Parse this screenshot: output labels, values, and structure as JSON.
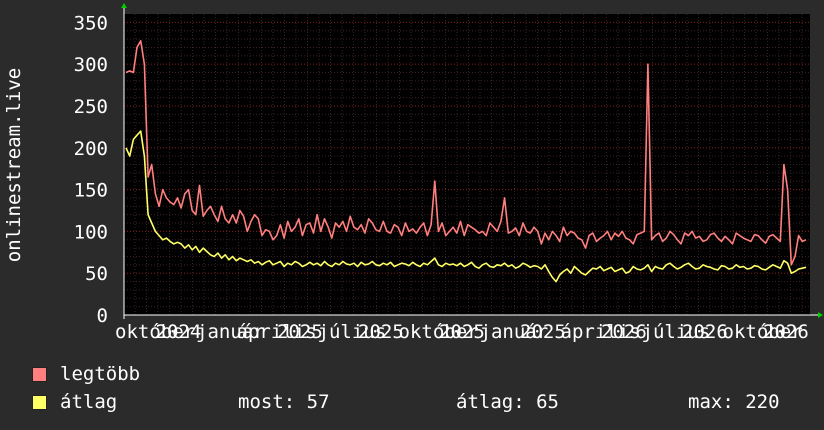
{
  "chart_data": {
    "type": "line",
    "ylabel": "onlinestream.live",
    "ylim": [
      0,
      360
    ],
    "yticks": [
      0,
      50,
      100,
      150,
      200,
      250,
      300,
      350
    ],
    "x_tick_labels": [
      "október",
      "2024",
      "január",
      "április",
      "2025",
      "július",
      "2025",
      "október",
      "2025",
      "január",
      "2025",
      "április",
      "2026",
      "július",
      "2026",
      "október",
      "2026"
    ],
    "grid": true,
    "colors": {
      "background": "#000000",
      "grid": "#8a1c1c",
      "max": "#ff7f7f",
      "avg": "#ffff66"
    },
    "series": [
      {
        "name": "legtöbb",
        "color": "#ff7f7f",
        "values": [
          290,
          292,
          290,
          320,
          328,
          300,
          165,
          180,
          145,
          130,
          150,
          140,
          135,
          132,
          140,
          128,
          145,
          150,
          125,
          120,
          155,
          118,
          125,
          130,
          120,
          112,
          130,
          115,
          110,
          120,
          110,
          125,
          118,
          100,
          112,
          120,
          115,
          95,
          102,
          100,
          90,
          95,
          108,
          92,
          112,
          100,
          105,
          115,
          95,
          108,
          110,
          98,
          120,
          100,
          115,
          105,
          92,
          110,
          105,
          112,
          100,
          118,
          105,
          102,
          108,
          98,
          115,
          110,
          102,
          100,
          112,
          100,
          98,
          108,
          105,
          95,
          110,
          100,
          103,
          98,
          105,
          110,
          95,
          108,
          160,
          100,
          110,
          95,
          100,
          105,
          98,
          112,
          95,
          108,
          105,
          102,
          98,
          100,
          95,
          110,
          105,
          100,
          112,
          140,
          98,
          100,
          104,
          95,
          110,
          100,
          98,
          105,
          100,
          85,
          98,
          90,
          100,
          95,
          88,
          105,
          95,
          100,
          98,
          92,
          90,
          80,
          95,
          98,
          88,
          92,
          95,
          100,
          90,
          98,
          94,
          100,
          92,
          90,
          85,
          96,
          98,
          100,
          300,
          90,
          95,
          98,
          88,
          92,
          100,
          96,
          90,
          85,
          98,
          95,
          100,
          92,
          94,
          88,
          90,
          96,
          98,
          92,
          88,
          94,
          90,
          85,
          98,
          95,
          92,
          90,
          88,
          96,
          95,
          90,
          86,
          94,
          96,
          92,
          88,
          180,
          150,
          60,
          70,
          95,
          88,
          90
        ]
      },
      {
        "name": "átlag",
        "color": "#ffff66",
        "values": [
          200,
          190,
          210,
          215,
          220,
          190,
          120,
          110,
          100,
          95,
          90,
          92,
          88,
          85,
          87,
          85,
          80,
          84,
          78,
          82,
          75,
          80,
          76,
          72,
          70,
          74,
          68,
          72,
          66,
          70,
          65,
          68,
          66,
          64,
          66,
          62,
          64,
          60,
          63,
          65,
          60,
          62,
          64,
          58,
          62,
          60,
          64,
          62,
          58,
          60,
          63,
          60,
          62,
          59,
          64,
          60,
          58,
          62,
          60,
          64,
          61,
          60,
          62,
          58,
          63,
          60,
          61,
          64,
          60,
          59,
          62,
          60,
          63,
          58,
          60,
          62,
          61,
          59,
          63,
          60,
          58,
          62,
          60,
          64,
          68,
          60,
          58,
          62,
          60,
          61,
          59,
          62,
          58,
          60,
          63,
          58,
          56,
          60,
          62,
          58,
          57,
          60,
          59,
          62,
          58,
          60,
          56,
          58,
          62,
          60,
          57,
          59,
          58,
          55,
          60,
          52,
          45,
          40,
          48,
          52,
          55,
          50,
          58,
          54,
          50,
          48,
          52,
          56,
          55,
          58,
          53,
          55,
          57,
          52,
          54,
          56,
          50,
          52,
          58,
          55,
          54,
          56,
          60,
          52,
          58,
          56,
          55,
          60,
          62,
          58,
          55,
          57,
          60,
          62,
          58,
          55,
          56,
          60,
          58,
          57,
          55,
          54,
          59,
          58,
          55,
          56,
          60,
          57,
          58,
          55,
          56,
          59,
          58,
          55,
          54,
          57,
          60,
          58,
          56,
          65,
          62,
          50,
          52,
          55,
          56,
          57
        ]
      }
    ]
  },
  "legend": [
    {
      "label": "legtöbb",
      "color": "#ff7f7f"
    },
    {
      "label": "átlag",
      "color": "#ffff66"
    }
  ],
  "stats": {
    "most": "most: 57",
    "atlag": "átlag: 65",
    "max": "max: 220"
  }
}
